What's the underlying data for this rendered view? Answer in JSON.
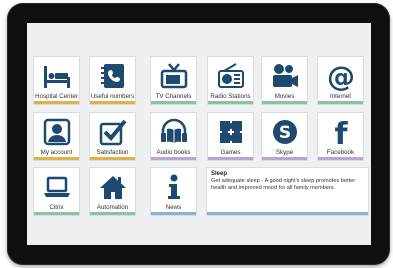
{
  "tiles": [
    {
      "label": "Hospital Center",
      "icon": "hospital-bed-icon",
      "bar": "#e2b24a"
    },
    {
      "label": "Useful numbers",
      "icon": "phonebook-icon",
      "bar": "#e2b24a"
    },
    {
      "label": "TV Channels",
      "icon": "tv-icon",
      "bar": "#8cc3a2"
    },
    {
      "label": "Radio Stations",
      "icon": "radio-icon",
      "bar": "#8cc3a2"
    },
    {
      "label": "Movies",
      "icon": "movie-camera-icon",
      "bar": "#8cc3a2"
    },
    {
      "label": "Internet",
      "icon": "at-sign-icon",
      "bar": "#8cc3a2"
    },
    {
      "label": "My account",
      "icon": "user-icon",
      "bar": "#e2b24a"
    },
    {
      "label": "Satisfaction",
      "icon": "checkbox-icon",
      "bar": "#e2b24a"
    },
    {
      "label": "Audio books",
      "icon": "headphones-book-icon",
      "bar": "#b8a4d8"
    },
    {
      "label": "Games",
      "icon": "puzzle-icon",
      "bar": "#b8a4d8"
    },
    {
      "label": "Skype",
      "icon": "skype-icon",
      "bar": "#b8a4d8"
    },
    {
      "label": "Facebook",
      "icon": "facebook-icon",
      "bar": "#b8a4d8"
    },
    {
      "label": "Citrix",
      "icon": "laptop-icon",
      "bar": "#8cc3a2"
    },
    {
      "label": "Automation",
      "icon": "home-icon",
      "bar": "#8cc3a2"
    },
    {
      "label": "News",
      "icon": "info-icon",
      "bar": "#8fb0d6"
    }
  ],
  "info_panel": {
    "title": "Sleep",
    "text": "Get adequate sleep - A good night's sleep promotes better health and improved mood for all family members."
  },
  "colors": {
    "icon": "#1d4a6e",
    "bezel": "#0f0f10",
    "screen": "#eef0f2"
  }
}
